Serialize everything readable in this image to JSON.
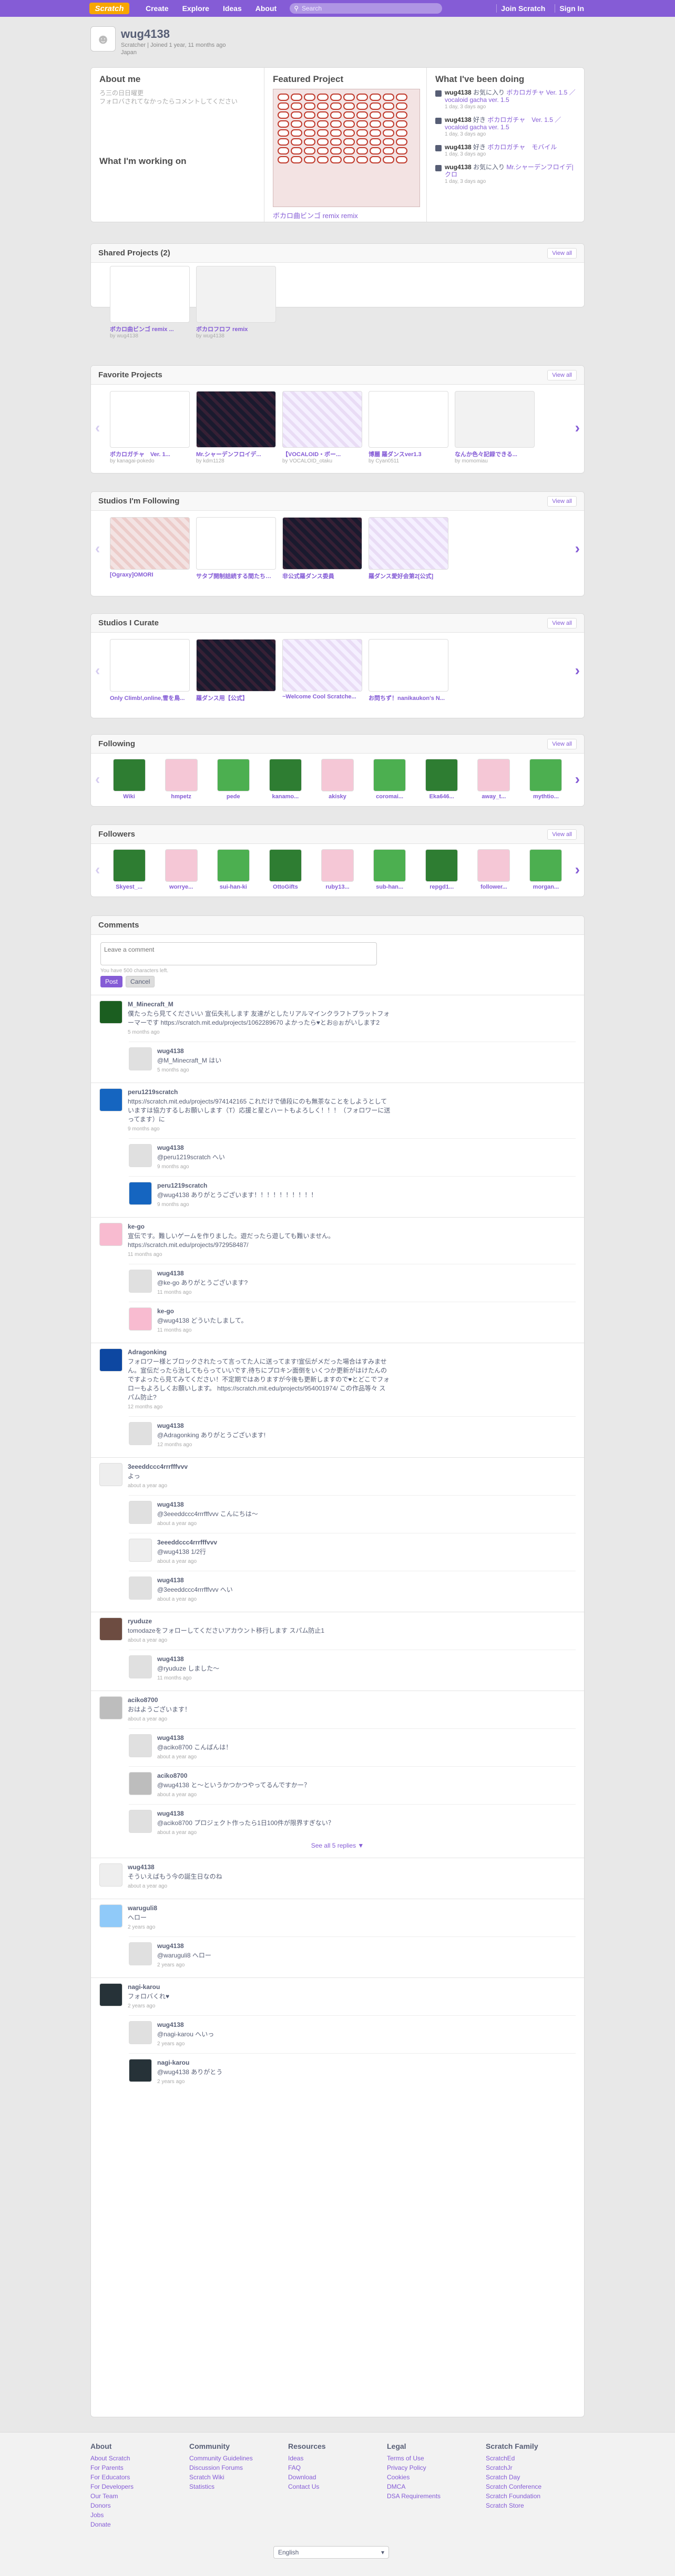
{
  "nav": {
    "logo": "Scratch",
    "items": [
      "Create",
      "Explore",
      "Ideas",
      "About"
    ],
    "search_placeholder": "Search",
    "join": "Join Scratch",
    "signin": "Sign In"
  },
  "profile": {
    "username": "wug4138",
    "sub": "Scratcher | Joined 1 year, 11 months ago",
    "country": "Japan"
  },
  "about": {
    "title": "About me",
    "bio": "ろ三の日日曜更\nフォロバされてなかったらコメントしてください",
    "working_title": "What I'm working on"
  },
  "featured": {
    "title": "Featured Project",
    "project": "ボカロ曲ビンゴ remix remix"
  },
  "doing": {
    "title": "What I've been doing",
    "items": [
      {
        "user": "wug4138",
        "verb": "お気に入り",
        "target": "ボカロガチャ Ver. 1.5 ／ vocaloid gacha ver. 1.5",
        "time": "1 day, 3 days ago"
      },
      {
        "user": "wug4138",
        "verb": "好き",
        "target": "ボカロガチャ　Ver. 1.5 ／ vocaloid gacha ver. 1.5",
        "time": "1 day, 3 days ago"
      },
      {
        "user": "wug4138",
        "verb": "好き",
        "target": "ボカロガチャ　モバイル",
        "time": "1 day, 3 days ago"
      },
      {
        "user": "wug4138",
        "verb": "お気に入り",
        "target": "Mr.シャーデンフロイデ|クロ",
        "time": "1 day, 3 days ago"
      }
    ]
  },
  "shared": {
    "title": "Shared Projects (2)",
    "viewall": "View all",
    "items": [
      {
        "title": "ボカロ曲ビンゴ remix ...",
        "by": "by wug4138"
      },
      {
        "title": "ボカロフロフ remix",
        "by": "by wug4138"
      }
    ]
  },
  "favorites": {
    "title": "Favorite Projects",
    "viewall": "View all",
    "items": [
      {
        "title": "ボカロガチャ　Ver. 1...",
        "by": "by kanagai-pokedo"
      },
      {
        "title": "Mr.シャーデンフロイデ...",
        "by": "by kdm1128"
      },
      {
        "title": "【VOCALOID・ボー...",
        "by": "by VOCALOID_otaku"
      },
      {
        "title": "博麗 羅ダンスver1.3",
        "by": "by Cyan0511"
      },
      {
        "title": "なんか色々記録できる...",
        "by": "by momomiau"
      }
    ]
  },
  "following_studios": {
    "title": "Studios I'm Following",
    "viewall": "View all",
    "items": [
      {
        "title": "[Ograxy]OMORI"
      },
      {
        "title": "サタブ開制詰続する間たちの集..."
      },
      {
        "title": "非公式羅ダンス委員"
      },
      {
        "title": "羅ダンス愛好会第2[公式]"
      }
    ]
  },
  "curate": {
    "title": "Studios I Curate",
    "viewall": "View all",
    "items": [
      {
        "title": "Only Climb!,online,雪を鳥..."
      },
      {
        "title": "羅ダンス用【公式】"
      },
      {
        "title": "~Welcome Cool Scratche..."
      },
      {
        "title": "お問ちず！nanikaukon's N..."
      }
    ]
  },
  "following": {
    "title": "Following",
    "viewall": "View all",
    "items": [
      "Wiki",
      "hmpetz",
      "pede",
      "kanamo...",
      "akisky",
      "coromai...",
      "Eka646...",
      "away_t...",
      "mythtio..."
    ]
  },
  "followers": {
    "title": "Followers",
    "viewall": "View all",
    "items": [
      "Skyest_...",
      "worrye...",
      "sui-han-ki",
      "OttoGifts",
      "ruby13...",
      "sub-han...",
      "repgd1...",
      "follower...",
      "morgan..."
    ]
  },
  "comments": {
    "title": "Comments",
    "placeholder": "Leave a comment",
    "left": "You have 500 characters left.",
    "post": "Post",
    "cancel": "Cancel",
    "seeall": "See all 5 replies ▼",
    "threads": [
      {
        "user": "M_Minecraft_M",
        "text": "僕たったら見てくださいい 宣伝失礼します 友達がとしたリアルマインクラフトプラットフォーマーです https://scratch.mit.edu/projects/1062289670 よかったら♥とお◎ぉがいします2",
        "date": "5 months ago",
        "replies": [
          {
            "user": "wug4138",
            "text": "@M_Minecraft_M はい",
            "date": "5 months ago"
          }
        ]
      },
      {
        "user": "peru1219scratch",
        "text": "https://scratch.mit.edu/projects/974142165 これだけで値段にのも無茶なことをしようとしていますは協力するしお願いします（T）応援と星とハートもよろしく！！！（フォロワーに送ってます）に",
        "date": "9 months ago",
        "replies": [
          {
            "user": "wug4138",
            "text": "@peru1219scratch へい",
            "date": "9 months ago"
          },
          {
            "user": "peru1219scratch",
            "text": "@wug4138 ありがとうございます！！！！！！！！！！",
            "date": "9 months ago"
          }
        ]
      },
      {
        "user": "ke-go",
        "text": "宣伝です。難しいゲームを作りました。遊だったら遊しても難いません。 https://scratch.mit.edu/projects/972958487/",
        "date": "11 months ago",
        "replies": [
          {
            "user": "wug4138",
            "text": "@ke-go ありがとうございます?",
            "date": "11 months ago"
          },
          {
            "user": "ke-go",
            "text": "@wug4138 どういたしまして。",
            "date": "11 months ago"
          }
        ]
      },
      {
        "user": "Adragonking",
        "text": "フォロワー様とブロックされたって言ってた人に送ってます!宣伝がメだった場合はすみません。宣伝だったら治してもらっていいです,待ちにプロキン面倒をいくつか更新がはけたんのですよったら見てみてください！不定期ではありますが今後も更新しますので♥とどこでフォローもよろしくお願いします。 https://scratch.mit.edu/projects/954001974/ この作品等々 スパム防止?",
        "date": "12 months ago",
        "replies": [
          {
            "user": "wug4138",
            "text": "@Adragonking ありがとうございます!",
            "date": "12 months ago"
          }
        ]
      },
      {
        "user": "3eeeddccc4rrrfffvvv",
        "text": "よっ",
        "date": "about a year ago",
        "replies": [
          {
            "user": "wug4138",
            "text": "@3eeeddccc4rrrfffvvv こんにちは～",
            "date": "about a year ago"
          },
          {
            "user": "3eeeddccc4rrrfffvvv",
            "text": "@wug4138 1/2行",
            "date": "about a year ago"
          },
          {
            "user": "wug4138",
            "text": "@3eeeddccc4rrrfffvvv へい",
            "date": "about a year ago"
          }
        ]
      },
      {
        "user": "ryuduze",
        "text": "tomodazeをフォローしてくださいアカウント移行します スパム防止1",
        "date": "about a year ago",
        "replies": [
          {
            "user": "wug4138",
            "text": "@ryuduze しました～",
            "date": "11 months ago"
          }
        ]
      },
      {
        "user": "aciko8700",
        "text": "おはようございます！",
        "date": "about a year ago",
        "replies": [
          {
            "user": "wug4138",
            "text": "@aciko8700 こんばんは！",
            "date": "about a year ago"
          },
          {
            "user": "aciko8700",
            "text": "@wug4138 と～というかつかつやってるんですかー？",
            "date": "about a year ago"
          },
          {
            "user": "wug4138",
            "text": "@aciko8700 プロジェクト作ったら1日100件が限界すぎない？",
            "date": "about a year ago"
          }
        ]
      },
      {
        "user": "wug4138",
        "text": "そういえばもう今の誕生日なのね",
        "date": "about a year ago",
        "replies": []
      },
      {
        "user": "waruguli8",
        "text": "へロー",
        "date": "2 years ago",
        "replies": [
          {
            "user": "wug4138",
            "text": "@waruguli8 へロー",
            "date": "2 years ago"
          }
        ]
      },
      {
        "user": "nagi-karou",
        "text": "フォロバくれ♥",
        "date": "2 years ago",
        "replies": [
          {
            "user": "wug4138",
            "text": "@nagi-karou へいっ",
            "date": "2 years ago"
          },
          {
            "user": "nagi-karou",
            "text": "@wug4138 ありがとう",
            "date": "2 years ago"
          }
        ]
      }
    ]
  },
  "footer": {
    "cols": [
      {
        "h": "About",
        "links": [
          "About Scratch",
          "For Parents",
          "For Educators",
          "For Developers",
          "Our Team",
          "Donors",
          "Jobs",
          "Donate"
        ]
      },
      {
        "h": "Community",
        "links": [
          "Community Guidelines",
          "Discussion Forums",
          "Scratch Wiki",
          "Statistics"
        ]
      },
      {
        "h": "Resources",
        "links": [
          "Ideas",
          "FAQ",
          "Download",
          "Contact Us"
        ]
      },
      {
        "h": "Legal",
        "links": [
          "Terms of Use",
          "Privacy Policy",
          "Cookies",
          "DMCA",
          "DSA Requirements"
        ]
      },
      {
        "h": "Scratch Family",
        "links": [
          "ScratchEd",
          "ScratchJr",
          "Scratch Day",
          "Scratch Conference",
          "Scratch Foundation",
          "Scratch Store"
        ]
      }
    ],
    "language": "English"
  },
  "colors": {
    "accent": "#855cd6",
    "nav": "#855cd6"
  }
}
